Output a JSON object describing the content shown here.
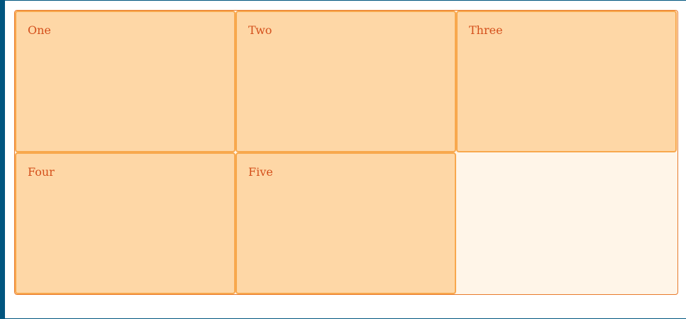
{
  "grid": {
    "items": [
      {
        "label": "One"
      },
      {
        "label": "Two"
      },
      {
        "label": "Three"
      },
      {
        "label": "Four"
      },
      {
        "label": "Five"
      }
    ]
  },
  "colors": {
    "frame": "#00557f",
    "container_border": "#e87a2c",
    "container_background": "#fff5e8",
    "item_border": "#f8a84d",
    "item_background": "#fed7a6",
    "item_text": "#d4501c"
  }
}
